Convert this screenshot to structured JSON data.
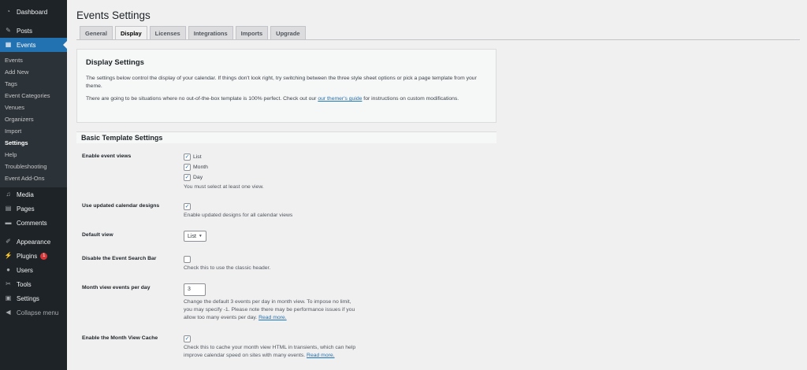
{
  "sidebar": {
    "top_items": [
      {
        "label": "Dashboard",
        "icon": "dashboard-icon"
      },
      {
        "label": "Posts",
        "icon": "pin-icon"
      },
      {
        "label": "Events",
        "icon": "calendar-icon"
      }
    ],
    "submenu": [
      "Events",
      "Add New",
      "Tags",
      "Event Categories",
      "Venues",
      "Organizers",
      "Import",
      "Settings",
      "Help",
      "Troubleshooting",
      "Event Add-Ons"
    ],
    "bottom_items": [
      {
        "label": "Media",
        "icon": "media-icon"
      },
      {
        "label": "Pages",
        "icon": "pages-icon"
      },
      {
        "label": "Comments",
        "icon": "comments-icon"
      },
      {
        "label": "Appearance",
        "icon": "brush-icon"
      },
      {
        "label": "Plugins",
        "icon": "plugin-icon",
        "badge": "1"
      },
      {
        "label": "Users",
        "icon": "user-icon"
      },
      {
        "label": "Tools",
        "icon": "wrench-icon"
      },
      {
        "label": "Settings",
        "icon": "settings-icon"
      },
      {
        "label": "Collapse menu",
        "icon": "collapse-icon"
      }
    ]
  },
  "page": {
    "title": "Events Settings",
    "tabs": [
      "General",
      "Display",
      "Licenses",
      "Integrations",
      "Imports",
      "Upgrade"
    ],
    "active_tab": "Display"
  },
  "panel": {
    "heading": "Display Settings",
    "p1": "The settings below control the display of your calendar. If things don't look right, try switching between the three style sheet options or pick a page template from your theme.",
    "p2_before": "There are going to be situations where no out-of-the-box template is 100% perfect. Check out our ",
    "p2_link": "our themer's guide",
    "p2_after": " for instructions on custom modifications."
  },
  "basic": {
    "heading": "Basic Template Settings",
    "event_views": {
      "label": "Enable event views",
      "options": [
        {
          "label": "List",
          "checked": true
        },
        {
          "label": "Month",
          "checked": true
        },
        {
          "label": "Day",
          "checked": true
        }
      ],
      "help": "You must select at least one view."
    },
    "updated_designs": {
      "label": "Use updated calendar designs",
      "checked": true,
      "help": "Enable updated designs for all calendar views"
    },
    "default_view": {
      "label": "Default view",
      "value": "List"
    },
    "search_bar": {
      "label": "Disable the Event Search Bar",
      "checked": false,
      "help": "Check this to use the classic header."
    },
    "month_events": {
      "label": "Month view events per day",
      "value": "3",
      "help_l1": "Change the default 3 events per day in month view. To impose no limit,",
      "help_l2": "you may specify -1. Please note there may be performance issues if you",
      "help_l3": "allow too many events per day. ",
      "link": "Read more."
    },
    "month_cache": {
      "label": "Enable the Month View Cache",
      "checked": true,
      "help_l1": "Check this to cache your month view HTML in transients, which can help",
      "help_l2": "improve calendar speed on sites with many events. ",
      "link": "Read more."
    }
  },
  "colors": {
    "sidebar_bg": "#1d2327",
    "accent": "#2271b1",
    "badge": "#d63638"
  }
}
